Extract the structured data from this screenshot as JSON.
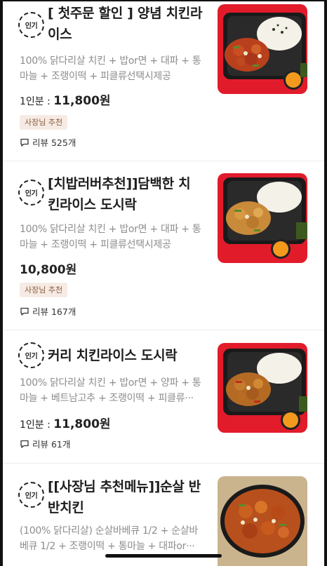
{
  "items": [
    {
      "badge": "인기",
      "title_line1": "[ 첫주문 할인 ] 양념 치킨라",
      "title_line2": "이스",
      "desc_line1": "100% 닭다리살 치킨 + 밥or면 + 대파 + 통",
      "desc_line2": "마늘 + 조랭이떡 + 피클류선택시제공",
      "price_prefix": "1인분 : ",
      "price": "11,800원",
      "tag": "사장님 추천",
      "review": "리뷰 525개",
      "image": "yangnyeom-chicken-rice-box"
    },
    {
      "badge": "인기",
      "title_line1": "[치밥러버추천]]담백한 치",
      "title_line2": "킨라이스  도시락",
      "desc_line1": "100% 닭다리살 치킨 + 밥or면 + 대파 + 통",
      "desc_line2": "마늘 + 조랭이떡 + 피클류선택시제공",
      "price_prefix": "",
      "price": "10,800원",
      "tag": "사장님 추천",
      "review": "리뷰 167개",
      "image": "plain-chicken-rice-box"
    },
    {
      "badge": "인기",
      "title_line1": "커리 치킨라이스  도시락",
      "title_line2": "",
      "desc_line1": "100% 닭다리살 치킨 + 밥or면 + 양파 + 통",
      "desc_line2": "마늘 + 베트남고추 + 조랭이떡 + 피클류···",
      "price_prefix": "1인분 : ",
      "price": "11,800원",
      "tag": "",
      "review": "리뷰 61개",
      "image": "curry-chicken-rice-box"
    },
    {
      "badge": "인기",
      "title_line1": "[[사장님 추천메뉴]]순살 반",
      "title_line2": "반치킨",
      "desc_line1": "(100% 닭다리살) 순살바베큐 1/2 + 순살바",
      "desc_line2": "베큐 1/2 + 조랭이떡 + 통마늘 + 대파or···",
      "image": "boneless-half-half-chicken"
    }
  ],
  "colors": {
    "thumb_bg": "#e21b2b",
    "tag_bg": "#f6ebe4",
    "tag_text": "#8a5a3c",
    "desc": "#8d8d8d"
  }
}
